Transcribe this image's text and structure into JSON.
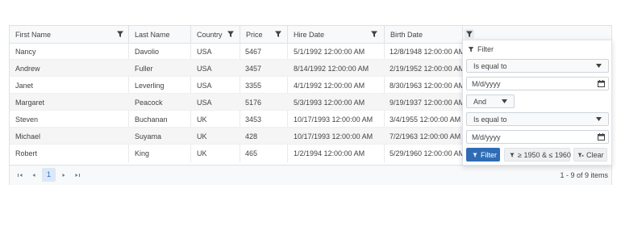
{
  "columns": [
    {
      "label": "First Name",
      "has_filter": true
    },
    {
      "label": "Last Name",
      "has_filter": false
    },
    {
      "label": "Country",
      "has_filter": true
    },
    {
      "label": "Price",
      "has_filter": true
    },
    {
      "label": "Hire Date",
      "has_filter": true
    },
    {
      "label": "Birth Date",
      "has_filter": true
    }
  ],
  "rows": [
    [
      "Nancy",
      "Davolio",
      "USA",
      "5467",
      "5/1/1992 12:00:00 AM",
      "12/8/1948 12:00:00 AM"
    ],
    [
      "Andrew",
      "Fuller",
      "USA",
      "3457",
      "8/14/1992 12:00:00 AM",
      "2/19/1952 12:00:00 AM"
    ],
    [
      "Janet",
      "Leverling",
      "USA",
      "3355",
      "4/1/1992 12:00:00 AM",
      "8/30/1963 12:00:00 AM"
    ],
    [
      "Margaret",
      "Peacock",
      "USA",
      "5176",
      "5/3/1993 12:00:00 AM",
      "9/19/1937 12:00:00 AM"
    ],
    [
      "Steven",
      "Buchanan",
      "UK",
      "3453",
      "10/17/1993 12:00:00 AM",
      "3/4/1955 12:00:00 AM"
    ],
    [
      "Michael",
      "Suyama",
      "UK",
      "428",
      "10/17/1993 12:00:00 AM",
      "7/2/1963 12:00:00 AM"
    ],
    [
      "Robert",
      "King",
      "UK",
      "465",
      "1/2/1994 12:00:00 AM",
      "5/29/1960 12:00:00 AM"
    ]
  ],
  "pager": {
    "current_page": "1",
    "info": "1 - 9 of 9 items"
  },
  "filter_popup": {
    "title": "Filter",
    "operator1": "Is equal to",
    "value1_placeholder": "M/d/yyyy",
    "logic": "And",
    "operator2": "Is equal to",
    "value2_placeholder": "M/d/yyyy",
    "filter_button": "Filter",
    "range_button": "≥ 1950 & ≤ 1960",
    "clear_button": "Clear"
  },
  "colors": {
    "primary": "#2f6cb5",
    "header_bg": "#f8f9fa",
    "alt_row": "#f5f5f5",
    "border": "#dee2e6"
  },
  "icons": {
    "filter": "filter-icon",
    "calendar": "calendar-icon",
    "clear_filter": "clear-filter-icon",
    "pager_first": "pager-first-icon",
    "pager_prev": "pager-prev-icon",
    "pager_next": "pager-next-icon",
    "pager_last": "pager-last-icon",
    "dropdown": "chevron-down-icon"
  }
}
